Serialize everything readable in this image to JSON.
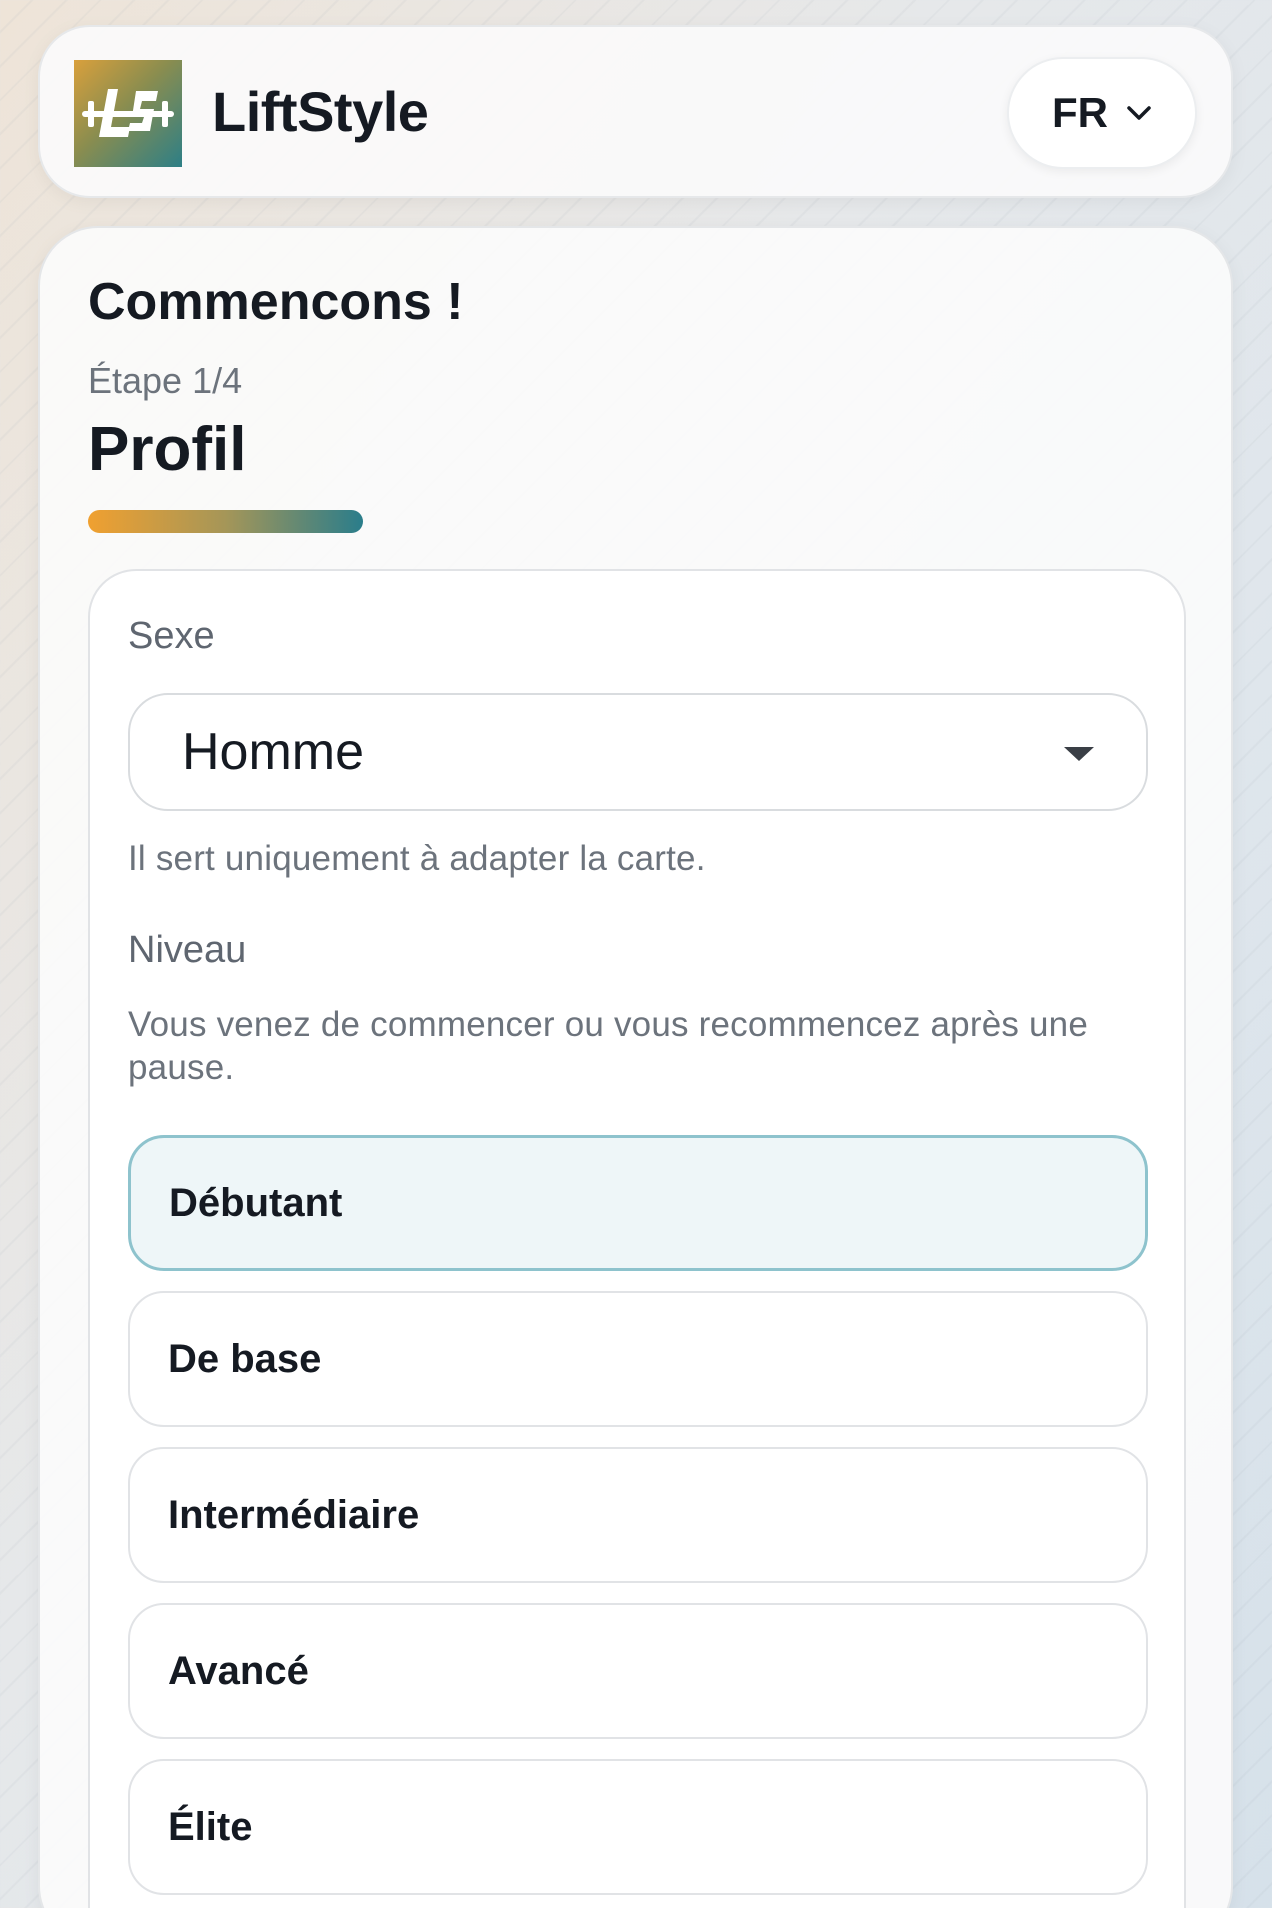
{
  "header": {
    "brand": "LiftStyle",
    "logo_icon": "liftstyle-logo-icon",
    "language": "FR"
  },
  "onboarding": {
    "title": "Commencons !",
    "step": "Étape 1/4",
    "step_title": "Profil",
    "progress_fraction": 0.25,
    "sex": {
      "label": "Sexe",
      "value": "Homme",
      "help": "Il sert uniquement à adapter la carte."
    },
    "level": {
      "label": "Niveau",
      "description": "Vous venez de commencer ou vous recommencez après une pause.",
      "options": [
        "Débutant",
        "De base",
        "Intermédiaire",
        "Avancé",
        "Élite"
      ],
      "selected": "Débutant"
    }
  },
  "colors": {
    "accent_start": "#f0a030",
    "accent_end": "#2a7d8b",
    "selected_bg": "#eef6f8",
    "selected_border": "#8ec3cd"
  }
}
